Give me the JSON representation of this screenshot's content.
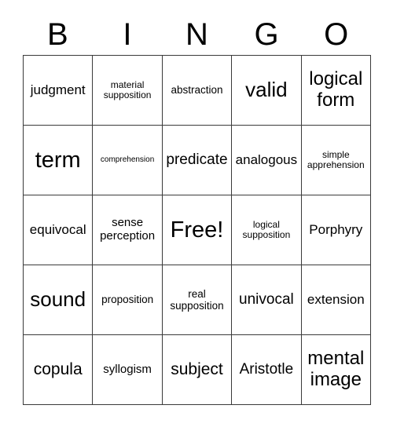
{
  "card": {
    "header": {
      "letters": [
        "B",
        "I",
        "N",
        "G",
        "O"
      ]
    },
    "columns": [
      "B",
      "I",
      "N",
      "G",
      "O"
    ],
    "rows": [
      {
        "cells": [
          {
            "label": "judgment",
            "size": "fs-sm"
          },
          {
            "label": "material supposition",
            "size": "fs-tiny"
          },
          {
            "label": "abstraction",
            "size": "fs-xxs"
          },
          {
            "label": "valid",
            "size": "fs-xl"
          },
          {
            "label": "logical form",
            "size": "fs-lg"
          }
        ]
      },
      {
        "cells": [
          {
            "label": "term",
            "size": "fs-xxl"
          },
          {
            "label": "comprehension",
            "size": "fs-micro"
          },
          {
            "label": "predicate",
            "size": "fs-md"
          },
          {
            "label": "analogous",
            "size": "fs-sm"
          },
          {
            "label": "simple apprehension",
            "size": "fs-tiny"
          }
        ]
      },
      {
        "cells": [
          {
            "label": "equivocal",
            "size": "fs-sm"
          },
          {
            "label": "sense perception",
            "size": "fs-xs"
          },
          {
            "label": "Free!",
            "size": "fs-xxl"
          },
          {
            "label": "logical supposition",
            "size": "fs-tiny"
          },
          {
            "label": "Porphyry",
            "size": "fs-sm"
          }
        ]
      },
      {
        "cells": [
          {
            "label": "sound",
            "size": "fs-xl"
          },
          {
            "label": "proposition",
            "size": "fs-xxs"
          },
          {
            "label": "real supposition",
            "size": "fs-xxs"
          },
          {
            "label": "univocal",
            "size": "fs-md"
          },
          {
            "label": "extension",
            "size": "fs-sm"
          }
        ]
      },
      {
        "cells": [
          {
            "label": "copula",
            "size": "fs-ml"
          },
          {
            "label": "syllogism",
            "size": "fs-xs"
          },
          {
            "label": "subject",
            "size": "fs-ml"
          },
          {
            "label": "Aristotle",
            "size": "fs-md"
          },
          {
            "label": "mental image",
            "size": "fs-lg"
          }
        ]
      }
    ],
    "free_space": {
      "row": 2,
      "column": 2,
      "label": "Free!"
    },
    "colors": {
      "background": "#ffffff",
      "border": "#3a3a3a",
      "text": "#000000"
    }
  }
}
